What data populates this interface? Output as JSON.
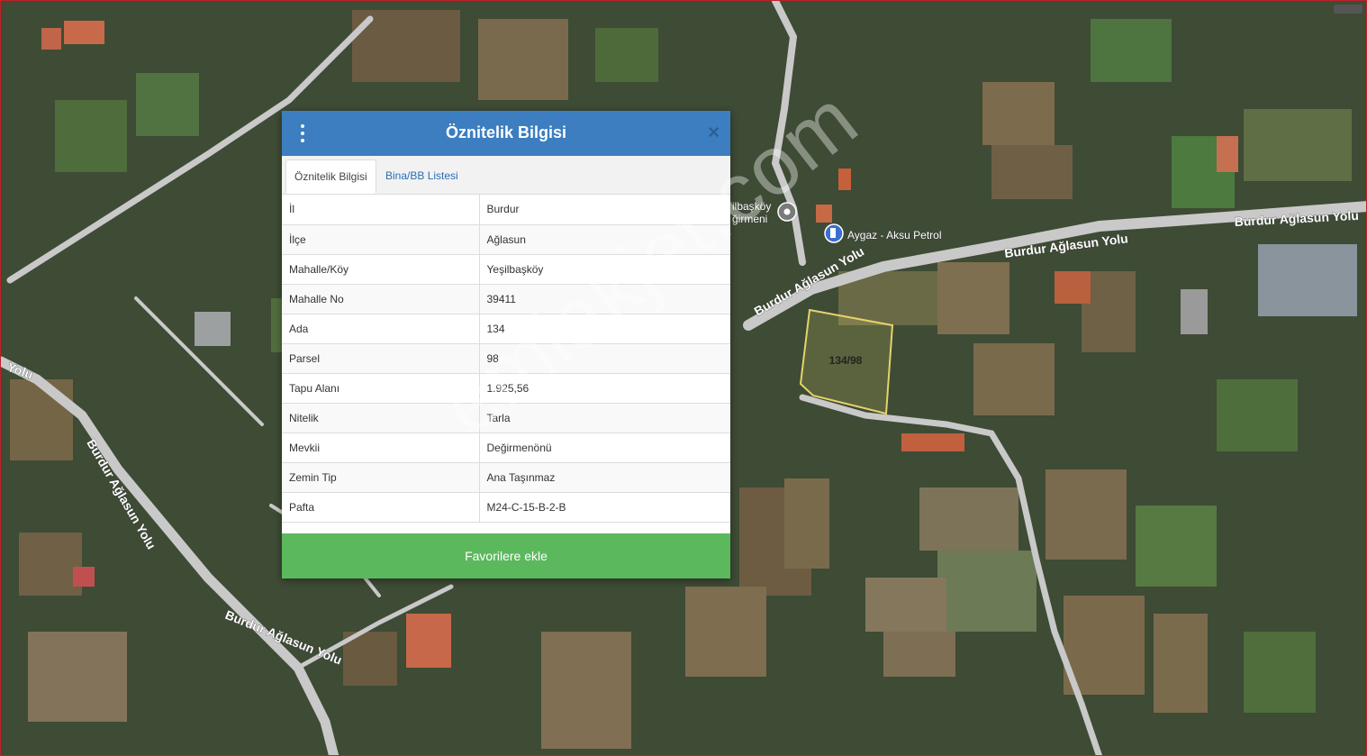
{
  "map": {
    "labels": {
      "road_1": "Burdur Ağlasun Yolu",
      "road_2": "Burdur Ağlasun Yolu",
      "road_3": "Burdur Ağlasun Yolu",
      "road_4": "Burdur Ağlasun Yolu",
      "road_5": "Burdur Ağlasun Yolu",
      "road_6": "Yolu",
      "poi_mill": "ilbaşköy\nğirmeni",
      "poi_fuel": "Aygaz - Aksu Petrol",
      "parcel": "134/98"
    },
    "parcel_outline_color": "#e5d36a",
    "road_color": "#c9c9c9"
  },
  "watermark": "emlakjet.com",
  "dialog": {
    "title": "Öznitelik Bilgisi",
    "menu_icon": "vertical-ellipsis-icon",
    "close_label": "×",
    "header_color": "#3c7ec0",
    "tabs": [
      "Öznitelik Bilgisi",
      "Bina/BB Listesi"
    ],
    "rows": [
      {
        "key": "İl",
        "value": "Burdur"
      },
      {
        "key": "İlçe",
        "value": "Ağlasun"
      },
      {
        "key": "Mahalle/Köy",
        "value": "Yeşilbaşköy"
      },
      {
        "key": "Mahalle No",
        "value": "39411"
      },
      {
        "key": "Ada",
        "value": "134"
      },
      {
        "key": "Parsel",
        "value": "98"
      },
      {
        "key": "Tapu Alanı",
        "value": "1.925,56"
      },
      {
        "key": "Nitelik",
        "value": "Tarla"
      },
      {
        "key": "Mevkii",
        "value": "Değirmenönü"
      },
      {
        "key": "Zemin Tip",
        "value": "Ana Taşınmaz"
      },
      {
        "key": "Pafta",
        "value": "M24-C-15-B-2-B"
      }
    ],
    "favorite_button": "Favorilere ekle",
    "favorite_color": "#5cb85c"
  }
}
